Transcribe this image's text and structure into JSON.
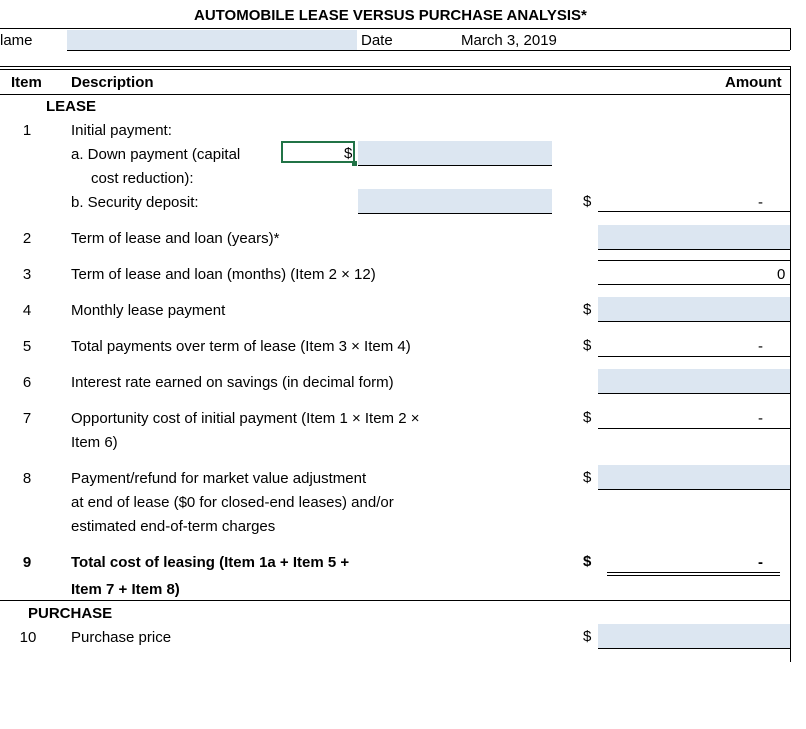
{
  "header": {
    "title": "AUTOMOBILE LEASE VERSUS PURCHASE ANALYSIS*",
    "name_label": "lame",
    "name_value": "",
    "date_label": "Date",
    "date_value": "March 3, 2019"
  },
  "columns": {
    "item": "Item",
    "description": "Description",
    "amount": "Amount"
  },
  "sections": {
    "lease": "LEASE",
    "purchase": "PURCHASE"
  },
  "items": {
    "i1": {
      "num": "1",
      "desc": "Initial payment:"
    },
    "i1a": {
      "line1": "a. Down payment (capital",
      "line2": "cost reduction):",
      "currency": "$"
    },
    "i1b": {
      "desc": "b. Security deposit:",
      "currency": "$",
      "amount": "-"
    },
    "i2": {
      "num": "2",
      "desc": "Term of lease and loan (years)*"
    },
    "i3": {
      "num": "3",
      "desc": "Term of lease and loan (months) (Item 2 × 12)",
      "amount": "0"
    },
    "i4": {
      "num": "4",
      "desc": "Monthly lease payment",
      "currency": "$"
    },
    "i5": {
      "num": "5",
      "desc": "Total payments over term of lease (Item 3 × Item 4)",
      "currency": "$",
      "amount": "-"
    },
    "i6": {
      "num": "6",
      "desc": "Interest rate earned on savings (in decimal form)"
    },
    "i7": {
      "num": "7",
      "line1": "Opportunity cost of initial payment (Item 1 × Item 2 ×",
      "line2": "Item 6)",
      "currency": "$",
      "amount": "-"
    },
    "i8": {
      "num": "8",
      "line1": "Payment/refund for market value adjustment",
      "line2": "at end of lease ($0 for closed-end leases) and/or",
      "line3": "estimated end-of-term charges",
      "currency": "$"
    },
    "i9": {
      "num": "9",
      "line1": "Total cost of leasing (Item 1a + Item 5 +",
      "line2": "Item 7 + Item 8)",
      "currency": "$",
      "amount": "-"
    },
    "i10": {
      "num": "10",
      "desc": "Purchase price",
      "currency": "$"
    }
  }
}
